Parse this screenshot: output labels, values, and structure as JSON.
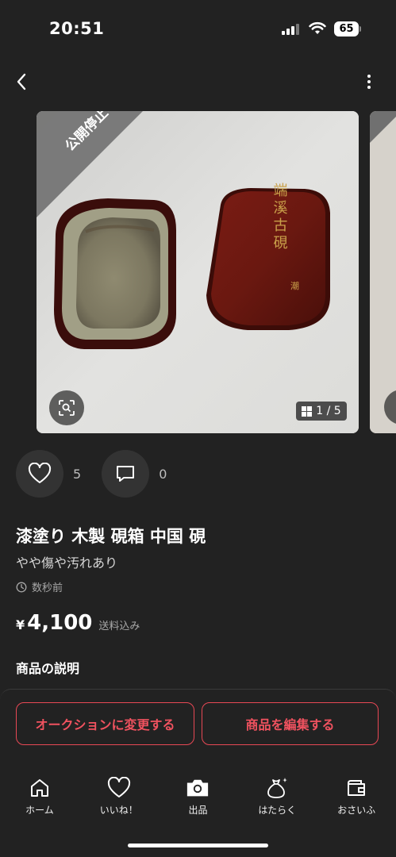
{
  "status_bar": {
    "time": "20:51",
    "battery": "65"
  },
  "nav": {
    "back_icon": "chevron-left-icon",
    "more_icon": "vertical-dots-icon"
  },
  "gallery": {
    "banner": "公開停止中",
    "counter": "1 / 5",
    "inkstone_lid_inscription": "端溪古硯"
  },
  "engagement": {
    "likes": "5",
    "comments": "0"
  },
  "item": {
    "title": "漆塗り 木製 硯箱 中国 硯",
    "condition": "やや傷や汚れあり",
    "posted": "数秒前",
    "price_symbol": "¥",
    "price": "4,100",
    "shipping": "送料込み",
    "description_heading": "商品の説明"
  },
  "actions": {
    "auction_button": "オークションに変更する",
    "edit_button": "商品を編集する"
  },
  "tabs": [
    {
      "label": "ホーム",
      "icon": "home-icon"
    },
    {
      "label": "いいね！",
      "icon": "heart-icon"
    },
    {
      "label": "出品",
      "icon": "camera-icon"
    },
    {
      "label": "はたらく",
      "icon": "money-bag-icon"
    },
    {
      "label": "おさいふ",
      "icon": "wallet-icon"
    }
  ],
  "colors": {
    "background": "#222222",
    "accent": "#e84855",
    "surface": "#333333"
  }
}
